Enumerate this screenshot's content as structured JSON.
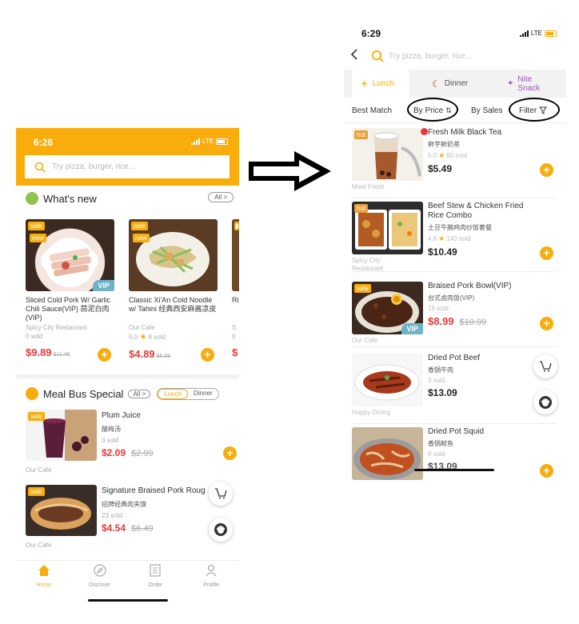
{
  "left": {
    "time": "6:28",
    "carrier": "LTE",
    "search_placeholder": "Try pizza, burger, rice...",
    "whats_new": {
      "title": "What's new",
      "all_label": "All >",
      "cards": [
        {
          "sale": "sale",
          "new": "new",
          "vip": "VIP",
          "name": "Sliced Cold Pork W/ Garlic Chili Sauce(VIP) 蒜泥白肉(VIP)",
          "restaurant": "Spicy City Restaurant",
          "stats": "0 sold",
          "price": "$9.89",
          "old_price": "$11.46"
        },
        {
          "sale": "sale",
          "new": "new",
          "name": "Classic Xi'An Cold Noodle w/ Tahini 经典西安麻酱凉皮",
          "restaurant": "Our Cafe",
          "rating": "5.0",
          "stats": "8 sold",
          "price": "$4.89",
          "old_price": "$5.99"
        },
        {
          "name": "Ri W 麋",
          "restaurant": "S",
          "stats": "0",
          "price": "$"
        }
      ]
    },
    "meal_bus": {
      "title": "Meal Bus Special",
      "all_label": "All >",
      "toggle": [
        "Lunch",
        "Dinner"
      ],
      "items": [
        {
          "sale": "sale",
          "name": "Plum Juice",
          "cn": "酸梅汤",
          "sold": "3 sold",
          "price": "$2.09",
          "old_price": "$2.99",
          "restaurant": "Our Cafe"
        },
        {
          "sale": "sale",
          "name": "Signature Braised Pork Roug",
          "cn": "招牌经典肉夹馍",
          "sold": "23 sold",
          "price": "$4.54",
          "old_price": "$6.49",
          "restaurant": "Our Cafe"
        }
      ]
    },
    "tabs": [
      {
        "label": "Home",
        "icon": "home-icon"
      },
      {
        "label": "Discover",
        "icon": "compass-icon"
      },
      {
        "label": "Order",
        "icon": "order-list-icon"
      },
      {
        "label": "Profile",
        "icon": "person-icon"
      }
    ]
  },
  "right": {
    "time": "6:29",
    "carrier": "LTE",
    "search_placeholder": "Try pizza, burger, rice...",
    "meal_tabs": [
      "Lunch",
      "Dinner",
      "Nite Snack"
    ],
    "sort": {
      "best_match": "Best Match",
      "by_price": "By Price",
      "by_sales": "By Sales",
      "filter": "Filter"
    },
    "items": [
      {
        "badge": "hot",
        "name": "Fresh Milk Black Tea",
        "cn": "鲜芋鲜奶茶",
        "rating": "5.0",
        "sold": "65 sold",
        "price": "$5.49",
        "restaurant": "Meet Fresh"
      },
      {
        "badge": "hot",
        "name": "Beef Stew & Chicken Fried Rice Combo",
        "cn": "土豆牛腩鸡肉炒饭套餐",
        "rating": "4.8",
        "sold": "140 sold",
        "price": "$10.49",
        "restaurant": "Spicy City Restaurant"
      },
      {
        "badge": "sale",
        "vip": "VIP",
        "name": "Braised Pork Bowl(VIP)",
        "cn": "台式卤肉饭(VIP)",
        "sold": "16 sold",
        "price": "$8.99",
        "old_price": "$10.99",
        "restaurant": "Our Cafe"
      },
      {
        "name": "Dried Pot Beef",
        "cn": "香锅牛肉",
        "sold": "3 sold",
        "price": "$13.09",
        "restaurant": "Happy Dining"
      },
      {
        "name": "Dried Pot Squid",
        "cn": "香锅鱿鱼",
        "sold": "6 sold",
        "price": "$13.09"
      }
    ]
  },
  "colors": {
    "brand": "#f9ad0d",
    "price_red": "#e8383a",
    "dinner_icon": "#c0392b",
    "nite_snack": "#9b59b6"
  }
}
